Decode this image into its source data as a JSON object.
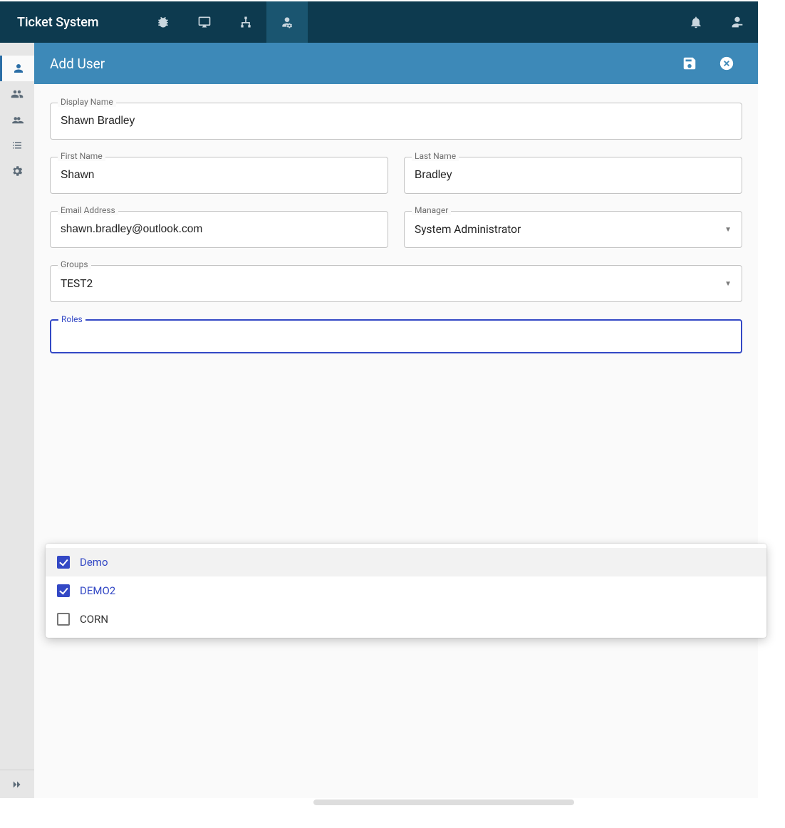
{
  "app": {
    "title": "Ticket System"
  },
  "topnav": [
    {
      "name": "bug",
      "active": false
    },
    {
      "name": "desktop",
      "active": false
    },
    {
      "name": "sitemap",
      "active": false
    },
    {
      "name": "user-admin",
      "active": true
    }
  ],
  "topbar_right": [
    {
      "name": "notifications"
    },
    {
      "name": "account"
    }
  ],
  "sidebar": [
    {
      "name": "user",
      "active": true
    },
    {
      "name": "group",
      "active": false
    },
    {
      "name": "roles",
      "active": false
    },
    {
      "name": "list",
      "active": false
    },
    {
      "name": "settings",
      "active": false
    }
  ],
  "page": {
    "title": "Add User",
    "actions": [
      {
        "name": "save"
      },
      {
        "name": "close"
      }
    ]
  },
  "form": {
    "display_name": {
      "label": "Display Name",
      "value": "Shawn Bradley"
    },
    "first_name": {
      "label": "First Name",
      "value": "Shawn"
    },
    "last_name": {
      "label": "Last Name",
      "value": "Bradley"
    },
    "email": {
      "label": "Email Address",
      "value": "shawn.bradley@outlook.com"
    },
    "manager": {
      "label": "Manager",
      "value": "System Administrator"
    },
    "groups": {
      "label": "Groups",
      "value": "TEST2"
    },
    "roles": {
      "label": "Roles",
      "value": ""
    }
  },
  "roles_options": [
    {
      "label": "Demo",
      "checked": true,
      "highlight": true
    },
    {
      "label": "DEMO2",
      "checked": true,
      "highlight": false
    },
    {
      "label": "CORN",
      "checked": false,
      "highlight": false
    }
  ]
}
